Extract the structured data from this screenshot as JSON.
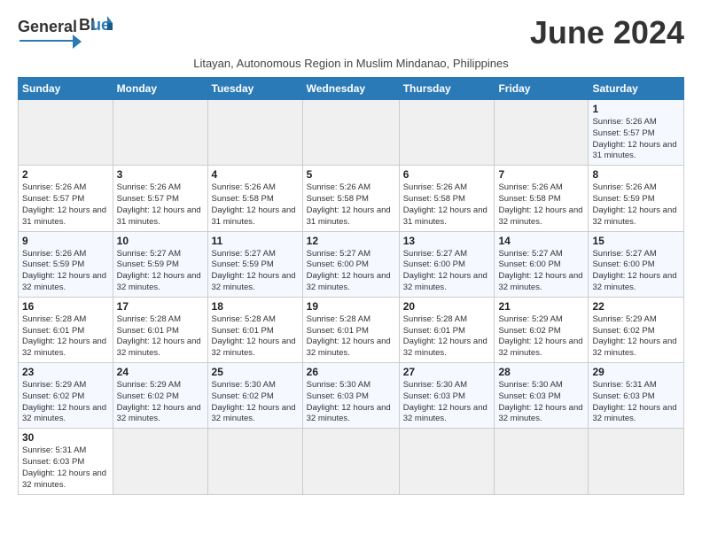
{
  "header": {
    "logo_general": "General",
    "logo_blue": "Blue",
    "month_title": "June 2024",
    "subtitle": "Litayan, Autonomous Region in Muslim Mindanao, Philippines"
  },
  "days_of_week": [
    "Sunday",
    "Monday",
    "Tuesday",
    "Wednesday",
    "Thursday",
    "Friday",
    "Saturday"
  ],
  "weeks": [
    [
      {
        "day": "",
        "info": ""
      },
      {
        "day": "",
        "info": ""
      },
      {
        "day": "",
        "info": ""
      },
      {
        "day": "",
        "info": ""
      },
      {
        "day": "",
        "info": ""
      },
      {
        "day": "",
        "info": ""
      },
      {
        "day": "1",
        "info": "Sunrise: 5:26 AM\nSunset: 5:57 PM\nDaylight: 12 hours and 31 minutes."
      }
    ],
    [
      {
        "day": "2",
        "info": "Sunrise: 5:26 AM\nSunset: 5:57 PM\nDaylight: 12 hours and 31 minutes."
      },
      {
        "day": "3",
        "info": "Sunrise: 5:26 AM\nSunset: 5:57 PM\nDaylight: 12 hours and 31 minutes."
      },
      {
        "day": "4",
        "info": "Sunrise: 5:26 AM\nSunset: 5:58 PM\nDaylight: 12 hours and 31 minutes."
      },
      {
        "day": "5",
        "info": "Sunrise: 5:26 AM\nSunset: 5:58 PM\nDaylight: 12 hours and 31 minutes."
      },
      {
        "day": "6",
        "info": "Sunrise: 5:26 AM\nSunset: 5:58 PM\nDaylight: 12 hours and 31 minutes."
      },
      {
        "day": "7",
        "info": "Sunrise: 5:26 AM\nSunset: 5:58 PM\nDaylight: 12 hours and 32 minutes."
      },
      {
        "day": "8",
        "info": "Sunrise: 5:26 AM\nSunset: 5:59 PM\nDaylight: 12 hours and 32 minutes."
      }
    ],
    [
      {
        "day": "9",
        "info": "Sunrise: 5:26 AM\nSunset: 5:59 PM\nDaylight: 12 hours and 32 minutes."
      },
      {
        "day": "10",
        "info": "Sunrise: 5:27 AM\nSunset: 5:59 PM\nDaylight: 12 hours and 32 minutes."
      },
      {
        "day": "11",
        "info": "Sunrise: 5:27 AM\nSunset: 5:59 PM\nDaylight: 12 hours and 32 minutes."
      },
      {
        "day": "12",
        "info": "Sunrise: 5:27 AM\nSunset: 6:00 PM\nDaylight: 12 hours and 32 minutes."
      },
      {
        "day": "13",
        "info": "Sunrise: 5:27 AM\nSunset: 6:00 PM\nDaylight: 12 hours and 32 minutes."
      },
      {
        "day": "14",
        "info": "Sunrise: 5:27 AM\nSunset: 6:00 PM\nDaylight: 12 hours and 32 minutes."
      },
      {
        "day": "15",
        "info": "Sunrise: 5:27 AM\nSunset: 6:00 PM\nDaylight: 12 hours and 32 minutes."
      }
    ],
    [
      {
        "day": "16",
        "info": "Sunrise: 5:28 AM\nSunset: 6:01 PM\nDaylight: 12 hours and 32 minutes."
      },
      {
        "day": "17",
        "info": "Sunrise: 5:28 AM\nSunset: 6:01 PM\nDaylight: 12 hours and 32 minutes."
      },
      {
        "day": "18",
        "info": "Sunrise: 5:28 AM\nSunset: 6:01 PM\nDaylight: 12 hours and 32 minutes."
      },
      {
        "day": "19",
        "info": "Sunrise: 5:28 AM\nSunset: 6:01 PM\nDaylight: 12 hours and 32 minutes."
      },
      {
        "day": "20",
        "info": "Sunrise: 5:28 AM\nSunset: 6:01 PM\nDaylight: 12 hours and 32 minutes."
      },
      {
        "day": "21",
        "info": "Sunrise: 5:29 AM\nSunset: 6:02 PM\nDaylight: 12 hours and 32 minutes."
      },
      {
        "day": "22",
        "info": "Sunrise: 5:29 AM\nSunset: 6:02 PM\nDaylight: 12 hours and 32 minutes."
      }
    ],
    [
      {
        "day": "23",
        "info": "Sunrise: 5:29 AM\nSunset: 6:02 PM\nDaylight: 12 hours and 32 minutes."
      },
      {
        "day": "24",
        "info": "Sunrise: 5:29 AM\nSunset: 6:02 PM\nDaylight: 12 hours and 32 minutes."
      },
      {
        "day": "25",
        "info": "Sunrise: 5:30 AM\nSunset: 6:02 PM\nDaylight: 12 hours and 32 minutes."
      },
      {
        "day": "26",
        "info": "Sunrise: 5:30 AM\nSunset: 6:03 PM\nDaylight: 12 hours and 32 minutes."
      },
      {
        "day": "27",
        "info": "Sunrise: 5:30 AM\nSunset: 6:03 PM\nDaylight: 12 hours and 32 minutes."
      },
      {
        "day": "28",
        "info": "Sunrise: 5:30 AM\nSunset: 6:03 PM\nDaylight: 12 hours and 32 minutes."
      },
      {
        "day": "29",
        "info": "Sunrise: 5:31 AM\nSunset: 6:03 PM\nDaylight: 12 hours and 32 minutes."
      }
    ],
    [
      {
        "day": "30",
        "info": "Sunrise: 5:31 AM\nSunset: 6:03 PM\nDaylight: 12 hours and 32 minutes."
      },
      {
        "day": "",
        "info": ""
      },
      {
        "day": "",
        "info": ""
      },
      {
        "day": "",
        "info": ""
      },
      {
        "day": "",
        "info": ""
      },
      {
        "day": "",
        "info": ""
      },
      {
        "day": "",
        "info": ""
      }
    ]
  ]
}
